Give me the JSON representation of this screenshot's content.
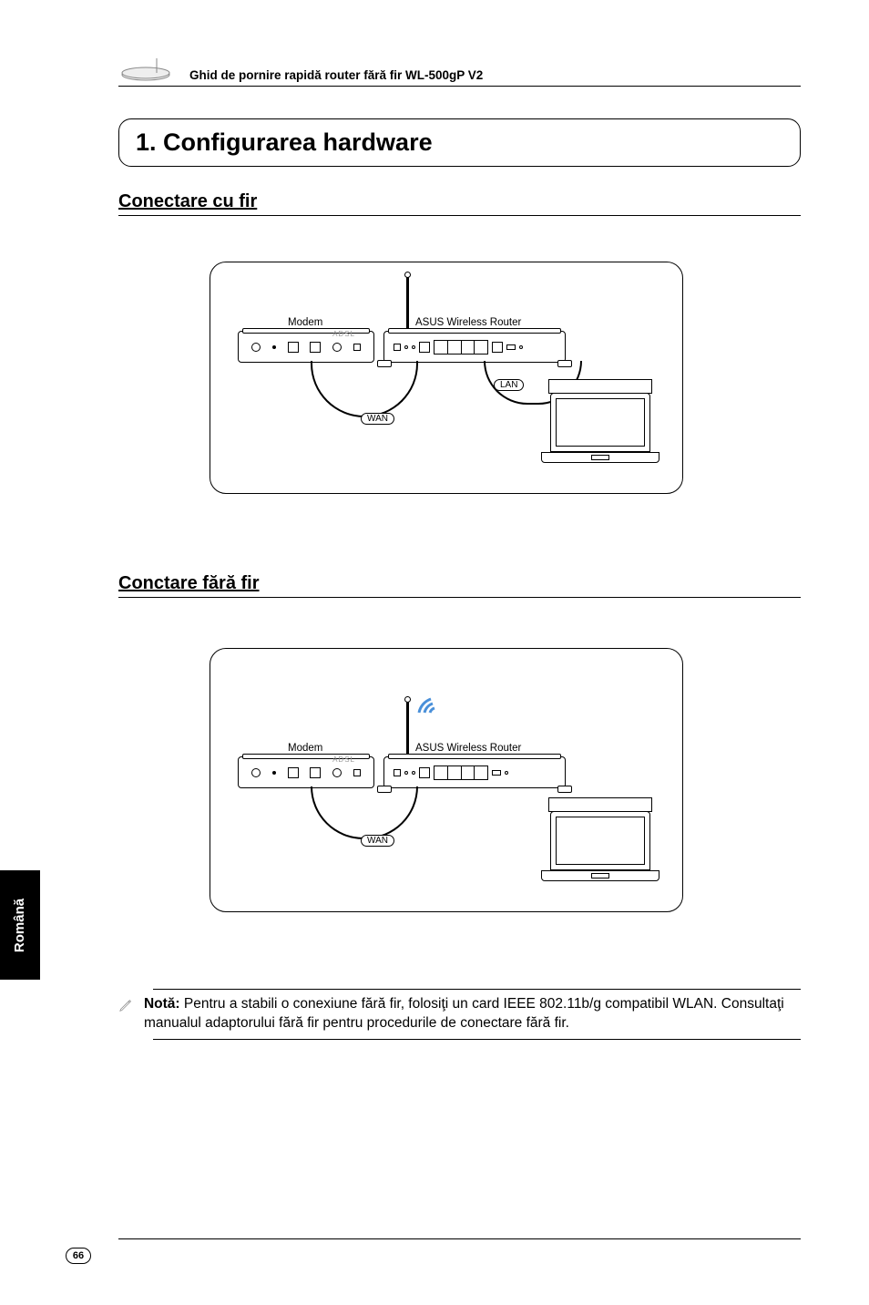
{
  "header": {
    "title": "Ghid de pornire rapidă router fără fir WL-500gP V2"
  },
  "section": {
    "number_title": "1. Configurarea hardware"
  },
  "subsection1": {
    "title": "Conectare cu fir",
    "diagram": {
      "modem_label": "Modem",
      "router_label": "ASUS Wireless Router",
      "wan_label": "WAN",
      "lan_label": "LAN",
      "adsl_label": "ADSL"
    }
  },
  "subsection2": {
    "title": "Conctare fără fir",
    "diagram": {
      "modem_label": "Modem",
      "router_label": "ASUS Wireless Router",
      "wan_label": "WAN",
      "adsl_label": "ADSL"
    }
  },
  "note": {
    "bold": "Notă:",
    "text": " Pentru a stabili o conexiune fără fir, folosiţi un card IEEE 802.11b/g compatibil WLAN. Consultaţi manualul adaptorului fără fir pentru procedurile de conectare fără fir."
  },
  "language_tab": "Română",
  "page_number": "66"
}
